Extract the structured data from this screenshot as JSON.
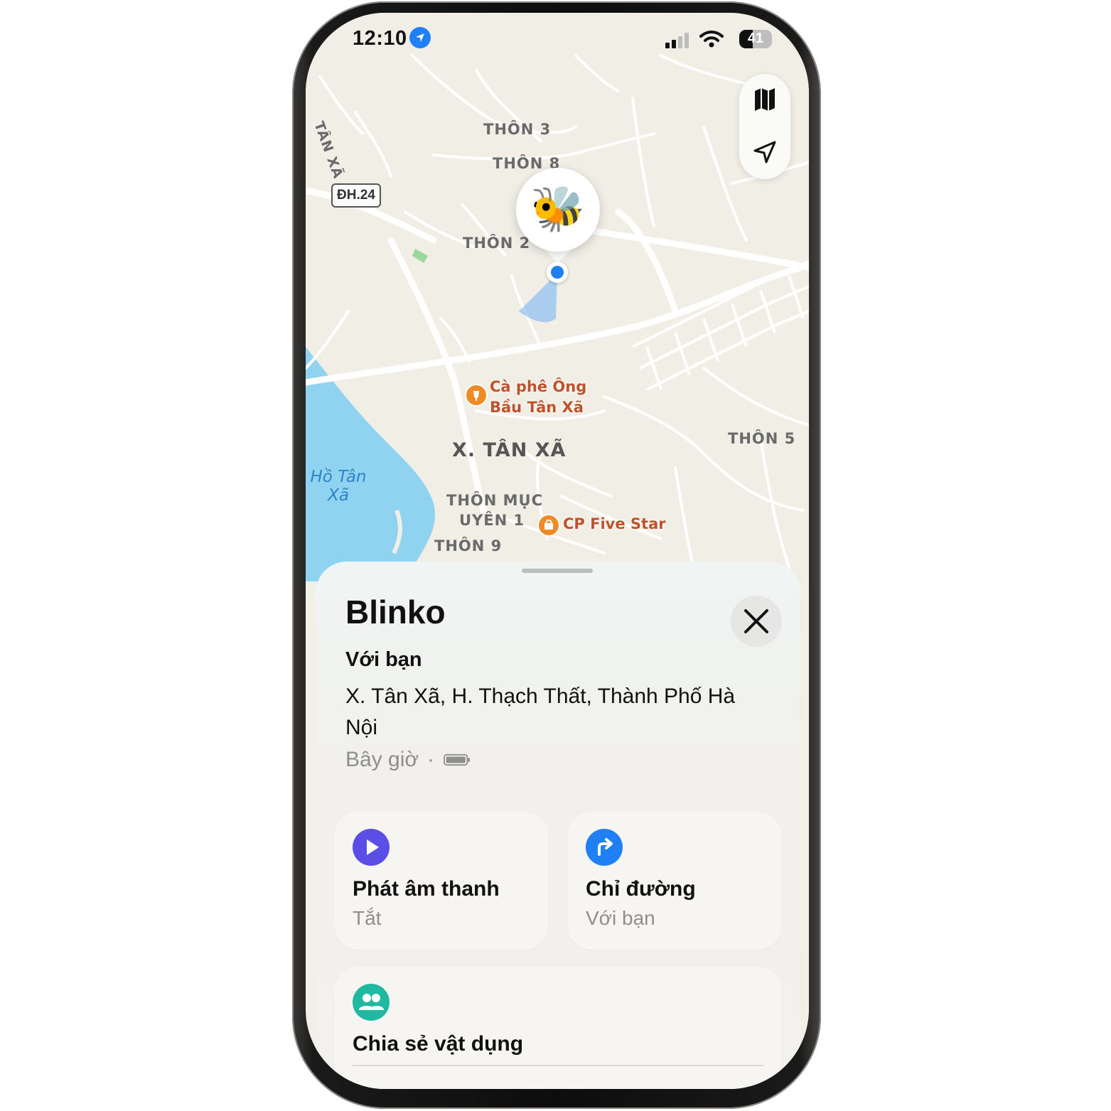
{
  "status_bar": {
    "time": "12:10",
    "battery_level": "41",
    "location_icon": "location-arrow-icon",
    "signal_icon": "cellular-signal-icon",
    "wifi_icon": "wifi-icon"
  },
  "map": {
    "road_badge": "ĐH.24",
    "labels": {
      "tan_xa_road": "TÂN XÃ",
      "thon_3": "THÔN 3",
      "thon_8": "THÔN 8",
      "thon_2": "THÔN 2",
      "thon_5": "THÔN 5",
      "x_tan_xa": "X. TÂN XÃ",
      "thon_muc_uyen_line1": "THÔN MỤC",
      "thon_muc_uyen_line2": "UYÊN 1",
      "thon_9": "THÔN 9"
    },
    "water": {
      "line1": "Hồ Tân",
      "line2": "Xã"
    },
    "pois": {
      "cafe_line1": "Cà phê Ông",
      "cafe_line2": "Bầu Tân Xã",
      "store": "CP Five Star"
    },
    "item_emoji": "🐝",
    "colors": {
      "water": "#8fd3f0",
      "user_dot": "#1f7ff5",
      "poi": "#f08a24"
    }
  },
  "sheet": {
    "title": "Blinko",
    "with_you": "Với bạn",
    "address": "X. Tân Xã, H. Thạch Thất, Thành Phố Hà Nội",
    "time_text": "Bây giờ",
    "separator": "·",
    "actions": {
      "play_sound": {
        "title": "Phát âm thanh",
        "subtitle": "Tắt",
        "color": "#5b4ee6"
      },
      "directions": {
        "title": "Chỉ đường",
        "subtitle": "Với bạn",
        "color": "#1f7ff5"
      },
      "share": {
        "title": "Chia sẻ vật dụng",
        "color": "#1fb8a0"
      }
    }
  }
}
